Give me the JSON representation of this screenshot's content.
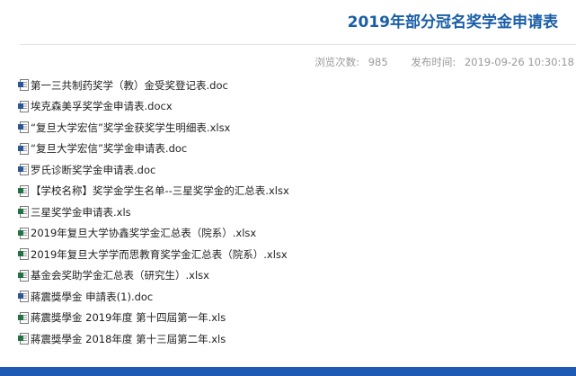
{
  "header": {
    "title": "2019年部分冠名奖学金申请表"
  },
  "meta": {
    "views_label": "浏览次数:",
    "views_value": "985",
    "published_label": "发布时间:",
    "published_value": "2019-09-26 10:30:18"
  },
  "files": [
    {
      "name": "第一三共制药奖学（教）金受奖登记表.doc",
      "icon": "word-doc-icon"
    },
    {
      "name": "埃克森美孚奖学金申请表.docx",
      "icon": "word-doc-icon"
    },
    {
      "name": "“复旦大学宏信”奖学金获奖学生明细表.xlsx",
      "icon": "word-doc-icon"
    },
    {
      "name": "“复旦大学宏信”奖学金申请表.doc",
      "icon": "word-doc-icon"
    },
    {
      "name": "罗氏诊断奖学金申请表.doc",
      "icon": "word-doc-icon"
    },
    {
      "name": "【学校名称】奖学金学生名单--三星奖学金的汇总表.xlsx",
      "icon": "excel-sheet-icon"
    },
    {
      "name": "三星奖学金申请表.xls",
      "icon": "excel-sheet-icon"
    },
    {
      "name": "2019年复旦大学协鑫奖学金汇总表（院系）.xlsx",
      "icon": "excel-sheet-icon"
    },
    {
      "name": "2019年复旦大学学而思教育奖学金汇总表（院系）.xlsx",
      "icon": "excel-sheet-icon"
    },
    {
      "name": "基金会奖助学金汇总表（研究生）.xlsx",
      "icon": "excel-sheet-icon"
    },
    {
      "name": "蔣震獎學金 申請表(1).doc",
      "icon": "word-doc-icon"
    },
    {
      "name": "蔣震獎學金 2019年度 第十四屆第一年.xls",
      "icon": "excel-sheet-icon"
    },
    {
      "name": "蔣震獎學金 2018年度 第十三屆第二年.xls",
      "icon": "excel-sheet-icon"
    }
  ],
  "colors": {
    "title": "#1a5ea8",
    "word_icon": "#2b5797",
    "excel_icon": "#217346",
    "bottom_bar": "#1e5ab4"
  }
}
